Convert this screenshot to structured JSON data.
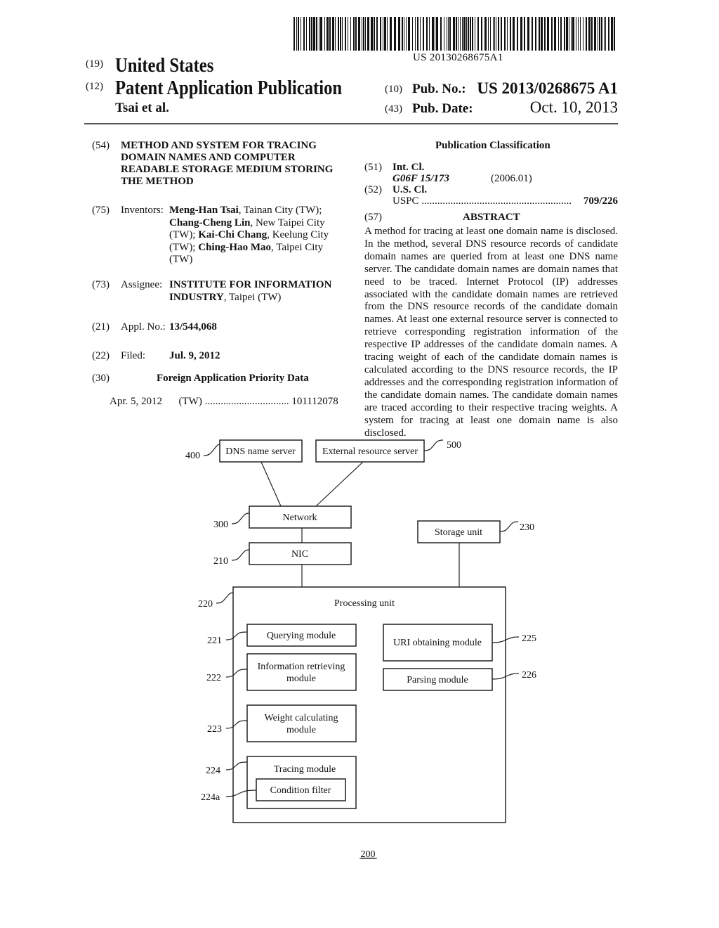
{
  "header": {
    "barcode_number": "US 20130268675A1",
    "code_19": "(19)",
    "country": "United States",
    "code_12": "(12)",
    "doc_type": "Patent Application Publication",
    "authors": "Tsai et al.",
    "code_10": "(10)",
    "pub_no_label": "Pub. No.:",
    "pub_no": "US 2013/0268675 A1",
    "code_43": "(43)",
    "pub_date_label": "Pub. Date:",
    "pub_date": "Oct. 10, 2013"
  },
  "left": {
    "title_code": "(54)",
    "title_lines": [
      "METHOD AND SYSTEM FOR TRACING",
      "DOMAIN NAMES AND COMPUTER",
      "READABLE STORAGE MEDIUM STORING",
      "THE METHOD"
    ],
    "inventors_code": "(75)",
    "inventors_label": "Inventors:",
    "inventors": [
      {
        "name": "Meng-Han Tsai",
        "location": ", Tainan City (TW);"
      },
      {
        "name": "Chang-Cheng Lin",
        "location": ", New Taipei City"
      },
      {
        "pre": "(TW); ",
        "name": "Kai-Chi Chang",
        "location": ", Keelung City"
      },
      {
        "pre": "(TW); ",
        "name": "Ching-Hao Mao",
        "location": ", Taipei City"
      },
      {
        "pre": "(TW)"
      }
    ],
    "assignee_code": "(73)",
    "assignee_label": "Assignee:",
    "assignee_line1": "INSTITUTE FOR INFORMATION",
    "assignee_line2_bold": "INDUSTRY",
    "assignee_line2_rest": ", Taipei (TW)",
    "appl_code": "(21)",
    "appl_label": "Appl. No.:",
    "appl_no": "13/544,068",
    "filed_code": "(22)",
    "filed_label": "Filed:",
    "filed_date": "Jul. 9, 2012",
    "foreign_code": "(30)",
    "foreign_title": "Foreign Application Priority Data",
    "foreign_date": "Apr. 5, 2012",
    "foreign_country": "(TW)",
    "foreign_dots": "................................",
    "foreign_number": "101112078"
  },
  "right": {
    "classification_title": "Publication Classification",
    "intcl_code": "(51)",
    "intcl_label": "Int. Cl.",
    "intcl_class": "G06F 15/173",
    "intcl_version": "(2006.01)",
    "uscl_code": "(52)",
    "uscl_label": "U.S. Cl.",
    "uspc_label": "USPC",
    "uspc_dots": ".........................................................",
    "uspc_value": "709/226",
    "abstract_code": "(57)",
    "abstract_title": "ABSTRACT",
    "abstract_text": "A method for tracing at least one domain name is disclosed. In the method, several DNS resource records of candidate domain names are queried from at least one DNS name server. The candidate domain names are domain names that need to be traced. Internet Protocol (IP) addresses associated with the candidate domain names are retrieved from the DNS resource records of the candidate domain names. At least one external resource server is connected to retrieve corresponding registration information of the respective IP addresses of the candidate domain names. A tracing weight of each of the candidate domain names is calculated according to the DNS resource records, the IP addresses and the corresponding registration information of the candidate domain names. The candidate domain names are traced according to their respective tracing weights. A system for tracing at least one domain name is also disclosed."
  },
  "diagram": {
    "figure_ref": "200",
    "dns_server": {
      "label": "DNS name server",
      "ref": "400"
    },
    "external_server": {
      "label": "External resource server",
      "ref": "500"
    },
    "network": {
      "label": "Network",
      "ref": "300"
    },
    "nic": {
      "label": "NIC",
      "ref": "210"
    },
    "storage": {
      "label": "Storage unit",
      "ref": "230"
    },
    "processing": {
      "label": "Processing unit",
      "ref": "220"
    },
    "querying": {
      "label": "Querying module",
      "ref": "221"
    },
    "info_retrieving": {
      "label_lines": [
        "Information retrieving",
        "module"
      ],
      "ref": "222"
    },
    "weight_calc": {
      "label_lines": [
        "Weight calculating",
        "module"
      ],
      "ref": "223"
    },
    "tracing": {
      "label": "Tracing module",
      "ref": "224"
    },
    "condition_filter": {
      "label": "Condition filter",
      "ref": "224a"
    },
    "uri_obtaining": {
      "label": "URI obtaining module",
      "ref": "225"
    },
    "parsing": {
      "label": "Parsing module",
      "ref": "226"
    }
  }
}
